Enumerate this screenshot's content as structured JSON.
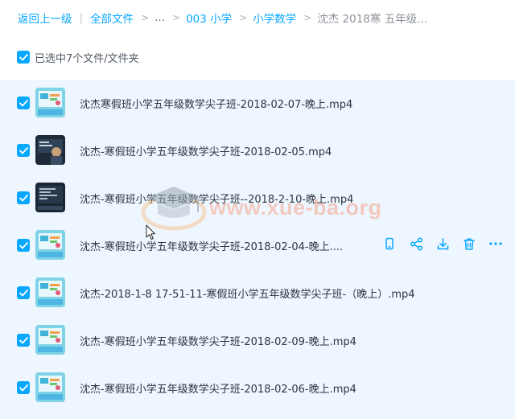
{
  "breadcrumb": {
    "back": "返回上一级",
    "separator": "|",
    "all_files": "全部文件",
    "ellipsis": "...",
    "level_1": "003 小学",
    "level_2": "小学数学",
    "current": "沈杰 2018寒 五年级..."
  },
  "selection": {
    "label": "已选中7个文件/文件夹"
  },
  "files": [
    {
      "name": "沈杰寒假班小学五年级数学尖子班-2018-02-07-晚上.mp4",
      "thumb": "colorful"
    },
    {
      "name": "沈杰-寒假班小学五年级数学尖子班-2018-02-05.mp4",
      "thumb": "dark-photo"
    },
    {
      "name": "沈杰-寒假班小学五年级数学尖子班--2018-2-10-晚上.mp4",
      "thumb": "dark-screen"
    },
    {
      "name": "沈杰-寒假班小学五年级数学尖子班-2018-02-04-晚上....",
      "thumb": "colorful"
    },
    {
      "name": "沈杰-2018-1-8 17-51-11-寒假班小学五年级数学尖子班-（晚上）.mp4",
      "thumb": "colorful"
    },
    {
      "name": "沈杰-寒假班小学五年级数学尖子班-2018-02-09-晚上.mp4",
      "thumb": "colorful"
    },
    {
      "name": "沈杰-寒假班小学五年级数学尖子班-2018-02-06-晚上.mp4",
      "thumb": "colorful"
    }
  ],
  "row_actions": [
    "phone-icon",
    "share-icon",
    "download-icon",
    "delete-icon",
    "more-icon"
  ],
  "watermark": {
    "text": "www.xue-ba.org"
  },
  "colors": {
    "accent": "#06a7ff",
    "list_background": "#eef6ff",
    "text": "#2c3540",
    "watermark": "#f6a58c"
  }
}
